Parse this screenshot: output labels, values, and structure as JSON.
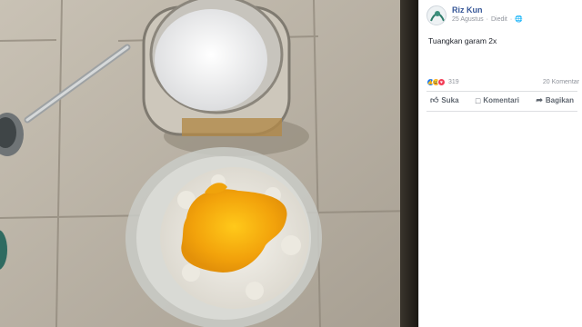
{
  "post": {
    "author": "Riz Kun",
    "date": "25 Agustus",
    "edited": "Diedit",
    "text": "Tuangkan garam 2x"
  },
  "reactions": {
    "count": "319",
    "comments": "20 Komentar"
  },
  "actions": {
    "like": "Suka",
    "comment": "Komentari",
    "share": "Bagikan"
  },
  "icons": {
    "avatar": "avatar-icon",
    "globe": "globe-icon",
    "like": "thumbs-up-icon",
    "comment": "comment-icon",
    "share": "share-icon"
  }
}
